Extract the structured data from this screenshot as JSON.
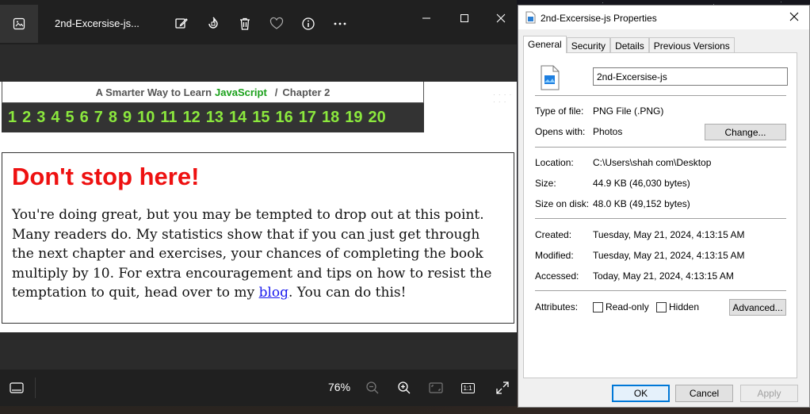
{
  "photos": {
    "title": "2nd-Excersise-js...",
    "toolbar_icons": [
      "edit-icon",
      "rotate-icon",
      "delete-icon",
      "favorite-icon",
      "info-icon",
      "more-icon"
    ],
    "image": {
      "header_prefix": "A Smarter Way to Learn",
      "header_brand": "JavaScript",
      "header_separator": "/",
      "header_chapter": "Chapter 2",
      "dots": "· · · · · · ·",
      "chapters": [
        "1",
        "2",
        "3",
        "4",
        "5",
        "6",
        "7",
        "8",
        "9",
        "10",
        "11",
        "12",
        "13",
        "14",
        "15",
        "16",
        "17",
        "18",
        "19",
        "20"
      ],
      "heading": "Don't stop here!",
      "paragraph_before_link": "You're doing great, but you may be tempted to drop out at this point. Many readers do. My statistics show that if you can just get through the next chapter and exercises, your chances of completing the book multiply by 10. For extra encouragement and tips on how to resist the temptation to quit, head over to my ",
      "link_text": "blog",
      "paragraph_after_link": ". You can do this!",
      "colors": {
        "heading": "#ee1111",
        "brand": "#1aa01a",
        "chapter_numbers": "#8be83d",
        "link": "#1a1aee"
      }
    },
    "bottombar": {
      "zoom": "76%",
      "actual_size_label": "1:1"
    }
  },
  "properties": {
    "title": "2nd-Excersise-js Properties",
    "tabs": [
      "General",
      "Security",
      "Details",
      "Previous Versions"
    ],
    "active_tab": "General",
    "filename": "2nd-Excersise-js",
    "type_label": "Type of file:",
    "type_value": "PNG File (.PNG)",
    "opens_label": "Opens with:",
    "opens_value": "Photos",
    "change_button": "Change...",
    "location_label": "Location:",
    "location_value": "C:\\Users\\shah com\\Desktop",
    "size_label": "Size:",
    "size_value": "44.9 KB (46,030 bytes)",
    "size_on_disk_label": "Size on disk:",
    "size_on_disk_value": "48.0 KB (49,152 bytes)",
    "created_label": "Created:",
    "created_value": "Tuesday, May 21, 2024, 4:13:15 AM",
    "modified_label": "Modified:",
    "modified_value": "Tuesday, May 21, 2024, 4:13:15 AM",
    "accessed_label": "Accessed:",
    "accessed_value": "Today, May 21, 2024, 4:13:15 AM",
    "attributes_label": "Attributes:",
    "readonly_label": "Read-only",
    "hidden_label": "Hidden",
    "advanced_button": "Advanced...",
    "ok_button": "OK",
    "cancel_button": "Cancel",
    "apply_button": "Apply"
  }
}
